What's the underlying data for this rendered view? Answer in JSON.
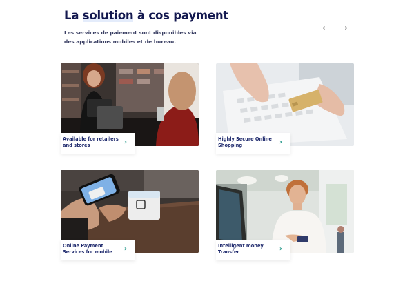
{
  "header": {
    "title_pre": "La ",
    "title_highlight": "solution",
    "title_post": " à cos payment",
    "subtitle": "Les services de paiement sont disponibles via des applications mobiles et de bureau."
  },
  "nav": {
    "prev_icon": "←",
    "next_icon": "→"
  },
  "cards": [
    {
      "label": "Available for retailers and stores",
      "chevron": "›",
      "image": "retail-store-checkout"
    },
    {
      "label": "Highly Secure Online Shopping",
      "chevron": "›",
      "image": "laptop-card-payment"
    },
    {
      "label": "Online Payment Services for mobile",
      "chevron": "›",
      "image": "mobile-contactless-payment"
    },
    {
      "label": "Intelligent money Transfer",
      "chevron": "›",
      "image": "cashier-with-card"
    }
  ],
  "colors": {
    "title": "#13184f",
    "label": "#1f2a6d",
    "accent": "#2a9a8c",
    "highlight": "#e4ecfb"
  }
}
